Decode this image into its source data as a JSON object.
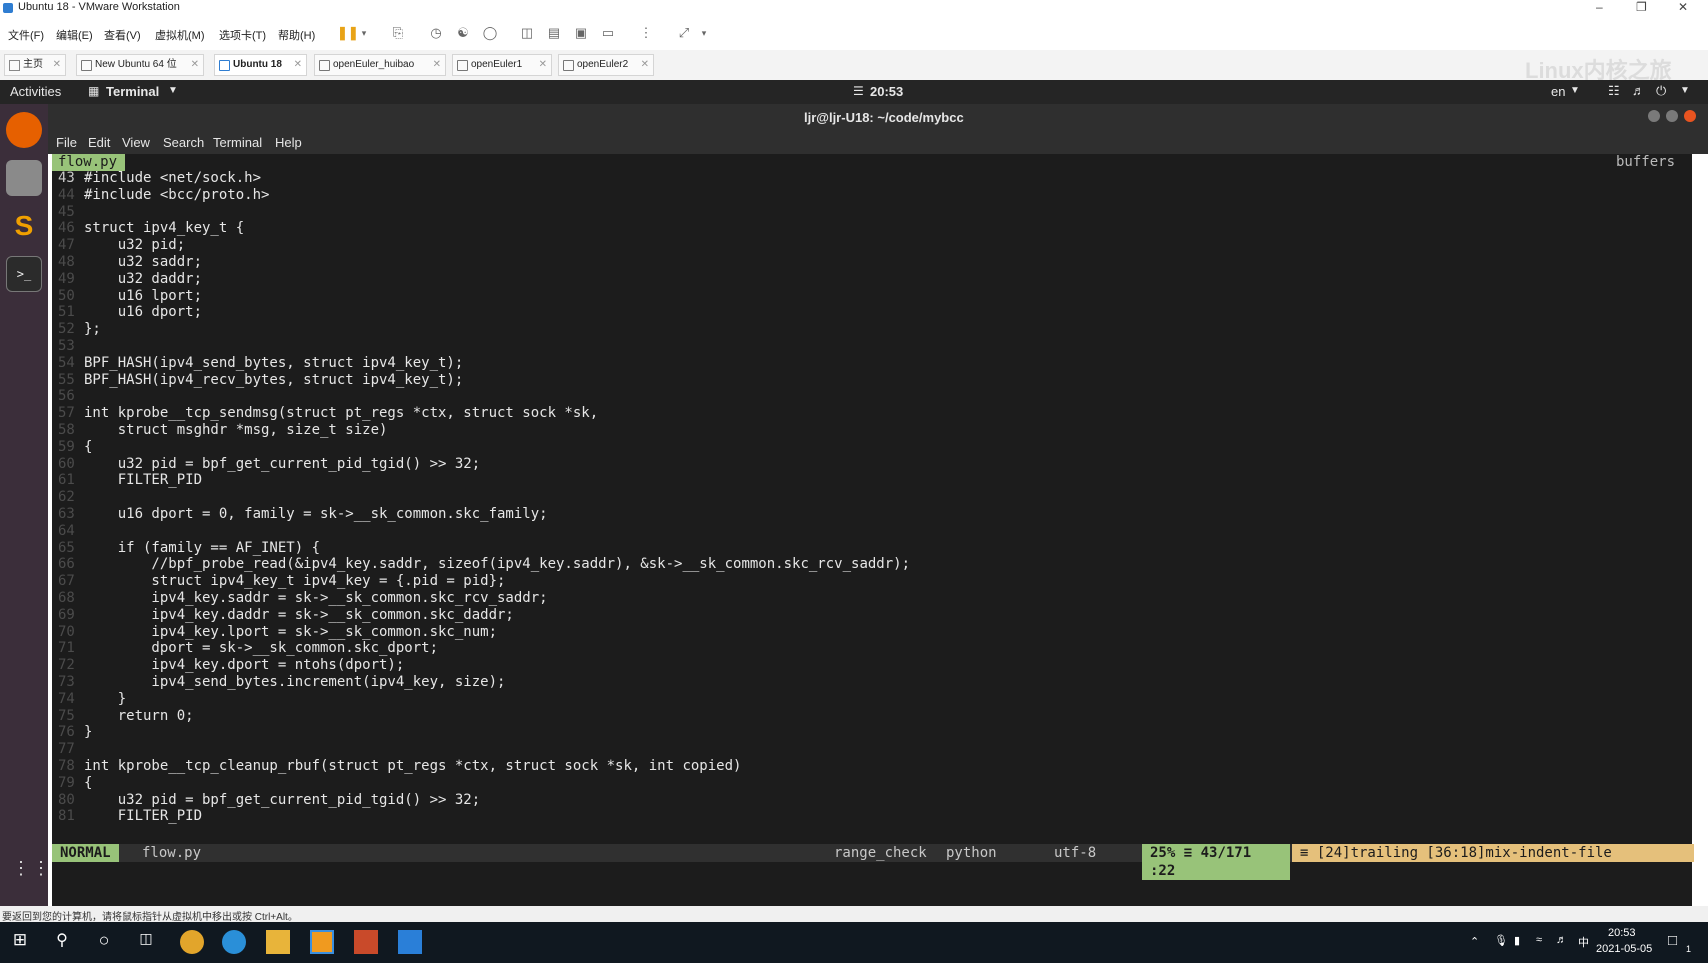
{
  "vmware": {
    "title": "Ubuntu 18 - VMware Workstation",
    "menu": [
      "文件(F)",
      "编辑(E)",
      "查看(V)",
      "虚拟机(M)",
      "选项卡(T)",
      "帮助(H)"
    ],
    "tabs": [
      {
        "label": "主页"
      },
      {
        "label": "New Ubuntu 64 位"
      },
      {
        "label": "Ubuntu 18"
      },
      {
        "label": "openEuler_huibao"
      },
      {
        "label": "openEuler1"
      },
      {
        "label": "openEuler2"
      }
    ],
    "watermark": "Linux内核之旅",
    "status_hint": "要返回到您的计算机，请将鼠标指针从虚拟机中移出或按 Ctrl+Alt。"
  },
  "gnome": {
    "activities": "Activities",
    "app": "Terminal",
    "clock": "20:53",
    "lang": "en"
  },
  "terminal": {
    "title": "ljr@ljr-U18: ~/code/mybcc",
    "menu": [
      "File",
      "Edit",
      "View",
      "Search",
      "Terminal",
      "Help"
    ],
    "buffer_tab": "flow.py",
    "buffers_label": "buffers",
    "lines": [
      {
        "n": "43",
        "t": "#include <net/sock.h>"
      },
      {
        "n": "44",
        "t": "#include <bcc/proto.h>"
      },
      {
        "n": "45",
        "t": ""
      },
      {
        "n": "46",
        "t": "struct ipv4_key_t {"
      },
      {
        "n": "47",
        "t": "    u32 pid;"
      },
      {
        "n": "48",
        "t": "    u32 saddr;"
      },
      {
        "n": "49",
        "t": "    u32 daddr;"
      },
      {
        "n": "50",
        "t": "    u16 lport;"
      },
      {
        "n": "51",
        "t": "    u16 dport;"
      },
      {
        "n": "52",
        "t": "};"
      },
      {
        "n": "53",
        "t": ""
      },
      {
        "n": "54",
        "t": "BPF_HASH(ipv4_send_bytes, struct ipv4_key_t);"
      },
      {
        "n": "55",
        "t": "BPF_HASH(ipv4_recv_bytes, struct ipv4_key_t);"
      },
      {
        "n": "56",
        "t": ""
      },
      {
        "n": "57",
        "t": "int kprobe__tcp_sendmsg(struct pt_regs *ctx, struct sock *sk,"
      },
      {
        "n": "58",
        "t": "    struct msghdr *msg, size_t size)"
      },
      {
        "n": "59",
        "t": "{"
      },
      {
        "n": "60",
        "t": "    u32 pid = bpf_get_current_pid_tgid() >> 32;"
      },
      {
        "n": "61",
        "t": "    FILTER_PID"
      },
      {
        "n": "62",
        "t": ""
      },
      {
        "n": "63",
        "t": "    u16 dport = 0, family = sk->__sk_common.skc_family;"
      },
      {
        "n": "64",
        "t": ""
      },
      {
        "n": "65",
        "t": "    if (family == AF_INET) {"
      },
      {
        "n": "66",
        "t": "        //bpf_probe_read(&ipv4_key.saddr, sizeof(ipv4_key.saddr), &sk->__sk_common.skc_rcv_saddr);"
      },
      {
        "n": "67",
        "t": "        struct ipv4_key_t ipv4_key = {.pid = pid};"
      },
      {
        "n": "68",
        "t": "        ipv4_key.saddr = sk->__sk_common.skc_rcv_saddr;"
      },
      {
        "n": "69",
        "t": "        ipv4_key.daddr = sk->__sk_common.skc_daddr;"
      },
      {
        "n": "70",
        "t": "        ipv4_key.lport = sk->__sk_common.skc_num;"
      },
      {
        "n": "71",
        "t": "        dport = sk->__sk_common.skc_dport;"
      },
      {
        "n": "72",
        "t": "        ipv4_key.dport = ntohs(dport);"
      },
      {
        "n": "73",
        "t": "        ipv4_send_bytes.increment(ipv4_key, size);"
      },
      {
        "n": "74",
        "t": "    }"
      },
      {
        "n": "75",
        "t": "    return 0;"
      },
      {
        "n": "76",
        "t": "}"
      },
      {
        "n": "77",
        "t": ""
      },
      {
        "n": "78",
        "t": "int kprobe__tcp_cleanup_rbuf(struct pt_regs *ctx, struct sock *sk, int copied)"
      },
      {
        "n": "79",
        "t": "{"
      },
      {
        "n": "80",
        "t": "    u32 pid = bpf_get_current_pid_tgid() >> 32;"
      },
      {
        "n": "81",
        "t": "    FILTER_PID"
      }
    ],
    "status": {
      "mode": "NORMAL",
      "file": "flow.py",
      "range_check": "range_check",
      "filetype": "python",
      "encoding": "utf-8",
      "percent": "25%",
      "position": "43/171",
      "column": ":22",
      "warnings": "[24]trailing [36:18]mix-indent-file"
    }
  },
  "taskbar": {
    "time": "20:53",
    "date": "2021-05-05",
    "ime": "中",
    "notif_count": "1"
  }
}
